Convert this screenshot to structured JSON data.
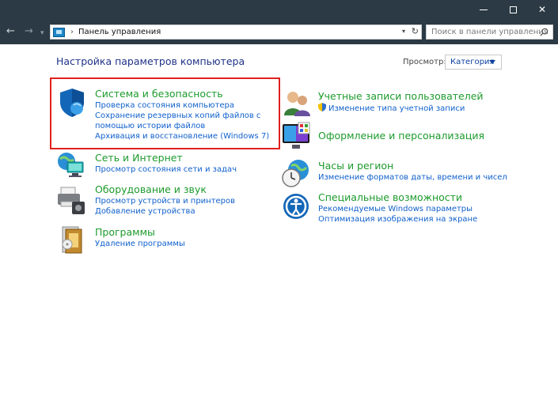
{
  "window": {
    "buttons": [
      "minimize",
      "maximize",
      "close"
    ]
  },
  "nav": {
    "address_text": "Панель управления",
    "search_placeholder": "Поиск в панели управления"
  },
  "main": {
    "title": "Настройка параметров компьютера",
    "view_label": "Просмотр:",
    "view_value": "Категория"
  },
  "categories_left": [
    {
      "title": "Система и безопасность",
      "icon": "shield-icon",
      "links": [
        "Проверка состояния компьютера",
        "Сохранение резервных копий файлов с помощью истории файлов",
        "Архивация и восстановление (Windows 7)"
      ]
    },
    {
      "title": "Сеть и Интернет",
      "icon": "network-globe-icon",
      "links": [
        "Просмотр состояния сети и задач"
      ]
    },
    {
      "title": "Оборудование и звук",
      "icon": "printer-icon",
      "links": [
        "Просмотр устройств и принтеров",
        "Добавление устройства"
      ]
    },
    {
      "title": "Программы",
      "icon": "programs-icon",
      "links": [
        "Удаление программы"
      ]
    }
  ],
  "categories_right": [
    {
      "title": "Учетные записи пользователей",
      "icon": "users-icon",
      "links": [
        "Изменение типа учетной записи"
      ]
    },
    {
      "title": "Оформление и персонализация",
      "icon": "monitor-palette-icon",
      "links": []
    },
    {
      "title": "Часы и регион",
      "icon": "clock-globe-icon",
      "links": [
        "Изменение форматов даты, времени и чисел"
      ]
    },
    {
      "title": "Специальные возможности",
      "icon": "accessibility-icon",
      "links": [
        "Рекомендуемые Windows параметры",
        "Оптимизация изображения на экране"
      ]
    }
  ],
  "colors": {
    "titlebar": "#2b3a44",
    "category_title": "#1d9b2d",
    "link": "#1060cc",
    "highlight": "#e0201e"
  }
}
